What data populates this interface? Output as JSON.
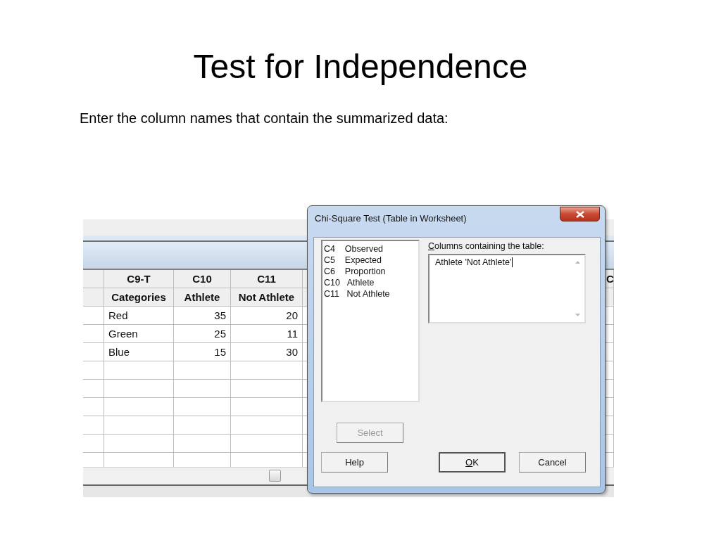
{
  "slide": {
    "title": "Test for Independence",
    "subtitle": "Enter the column names that contain the summarized data:"
  },
  "worksheet": {
    "columns": [
      {
        "id": "C9-T",
        "name": "Categories",
        "kind": "text"
      },
      {
        "id": "C10",
        "name": "Athlete",
        "kind": "numeric"
      },
      {
        "id": "C11",
        "name": "Not Athlete",
        "kind": "numeric"
      }
    ],
    "rows": [
      [
        "Red",
        "35",
        "20"
      ],
      [
        "Green",
        "25",
        "11"
      ],
      [
        "Blue",
        "15",
        "30"
      ]
    ],
    "cut_column": "C"
  },
  "dialog": {
    "title": "Chi-Square Test (Table in Worksheet)",
    "variables": [
      {
        "text": "C4    Observed"
      },
      {
        "text": "C5    Expected"
      },
      {
        "text": "C6    Proportion"
      },
      {
        "text": "C10   Athlete"
      },
      {
        "text": "C11   Not Athlete"
      }
    ],
    "field": {
      "label": "Columns containing the table:",
      "mnemonic": true,
      "value": "Athlete 'Not Athlete'"
    },
    "buttons": [
      {
        "label": "Select",
        "kind": "select",
        "disabled": true,
        "default": false,
        "mnemonic": false
      },
      {
        "label": "Help",
        "kind": "help",
        "disabled": false,
        "default": false,
        "mnemonic": false
      },
      {
        "label": "OK",
        "kind": "ok",
        "disabled": false,
        "default": true,
        "mnemonic": true
      },
      {
        "label": "Cancel",
        "kind": "cancel",
        "disabled": false,
        "default": false,
        "mnemonic": false
      }
    ]
  }
}
